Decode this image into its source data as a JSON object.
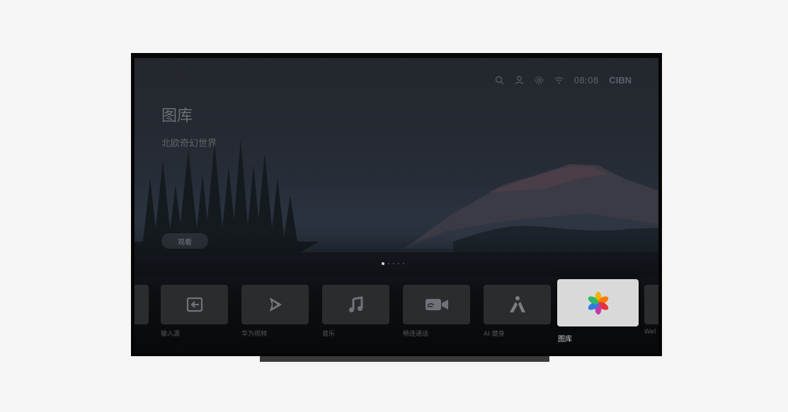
{
  "status_bar": {
    "clock": "08:08",
    "brand": "CIBN",
    "icons": [
      "search-icon",
      "user-icon",
      "settings-icon",
      "wifi-icon"
    ]
  },
  "hero": {
    "title": "图库",
    "subtitle": "北欧奇幻世界",
    "action_label": "观看"
  },
  "carousel": {
    "total_pages": 5,
    "current_page": 1
  },
  "dock": {
    "items": [
      {
        "label": "",
        "icon": "partial-tile"
      },
      {
        "label": "输入源",
        "icon": "input-source-icon"
      },
      {
        "label": "华为视频",
        "icon": "play-icon"
      },
      {
        "label": "音乐",
        "icon": "music-note-icon"
      },
      {
        "label": "畅连通话",
        "icon": "video-call-icon"
      },
      {
        "label": "AI 健身",
        "icon": "fitness-icon"
      },
      {
        "label": "图库",
        "icon": "gallery-pinwheel-icon",
        "focused": true
      },
      {
        "label": "Wel",
        "icon": "partial-tile"
      }
    ]
  },
  "colors": {
    "screen_background": "#23272d",
    "tile_background": "#2b2c2e",
    "focused_tile": "#d9d9d9"
  }
}
